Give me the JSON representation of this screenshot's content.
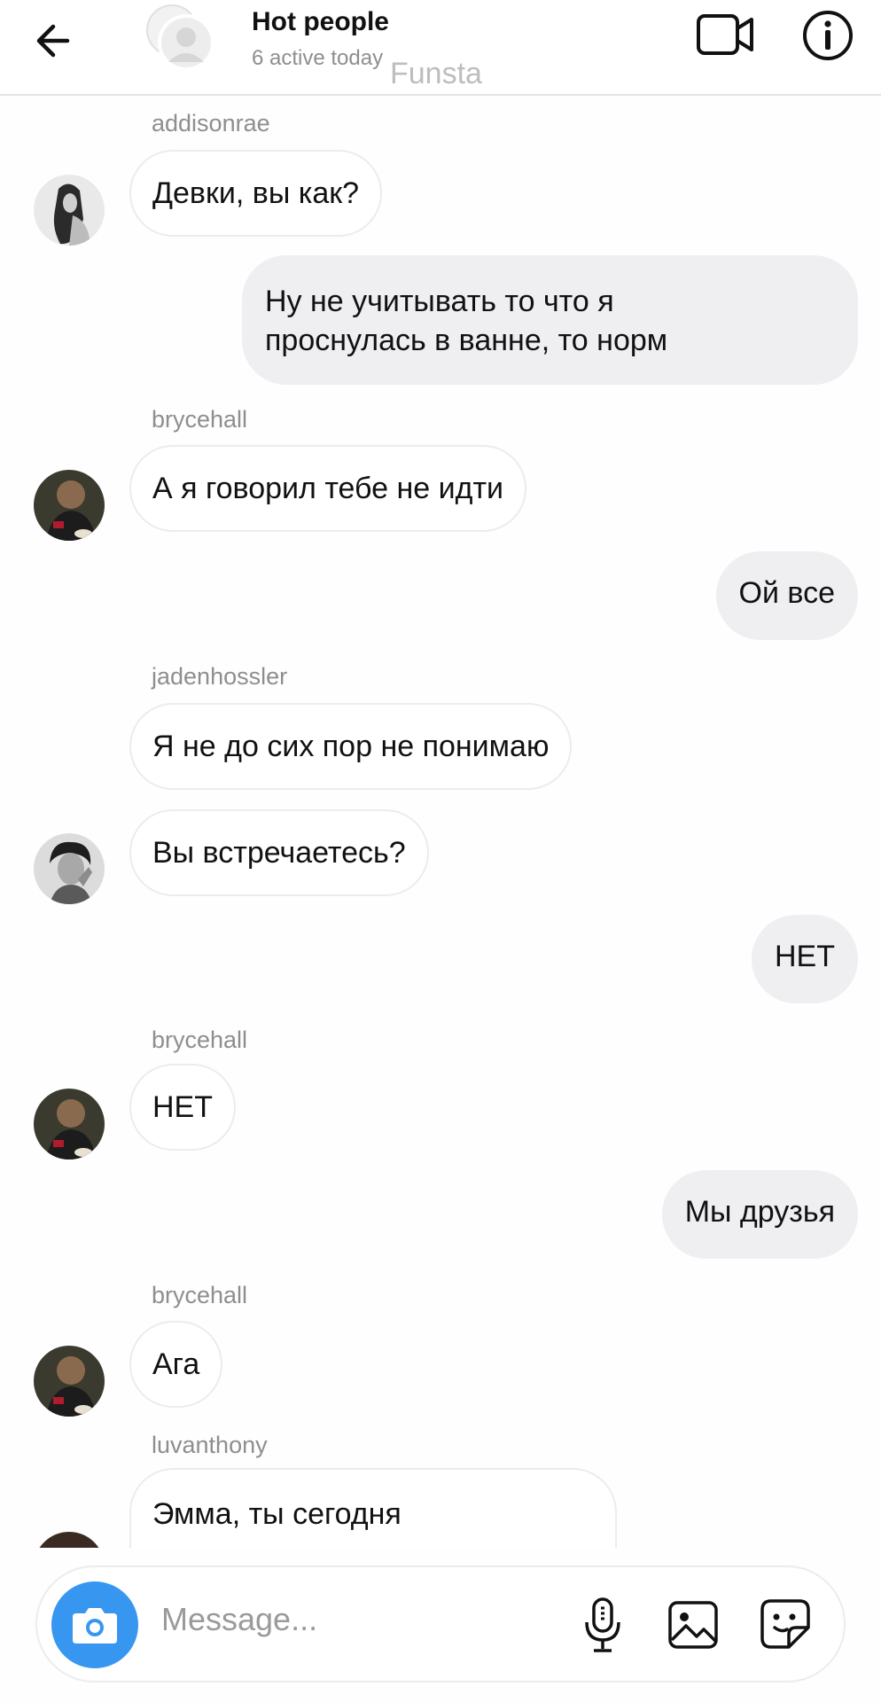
{
  "header": {
    "title": "Hot people",
    "subtitle": "6 active today",
    "watermark": "Funsta",
    "icons": [
      "back-arrow-icon",
      "group-avatar-icon",
      "video-call-icon",
      "info-icon"
    ]
  },
  "messages": [
    {
      "sender": "addisonrae",
      "direction": "in",
      "text": "Девки, вы как?"
    },
    {
      "sender": "me",
      "direction": "out",
      "lines": [
        "Ну не учитывать то что я",
        "проснулась в ванне, то норм"
      ]
    },
    {
      "sender": "brycehall",
      "direction": "in",
      "text": "А я говорил тебе не идти"
    },
    {
      "sender": "me",
      "direction": "out",
      "text": "Ой все"
    },
    {
      "sender": "jadenhossler",
      "direction": "in",
      "text": "Я не до сих пор не понимаю"
    },
    {
      "sender": "jadenhossler",
      "direction": "in",
      "text": "Вы встречаетесь?"
    },
    {
      "sender": "me",
      "direction": "out",
      "text": "НЕТ"
    },
    {
      "sender": "brycehall",
      "direction": "in",
      "text": "НЕТ"
    },
    {
      "sender": "me",
      "direction": "out",
      "text": "Мы друзья"
    },
    {
      "sender": "brycehall",
      "direction": "in",
      "text": "Ага"
    },
    {
      "sender": "luvanthony",
      "direction": "in",
      "text": "Эмма, ты сегодня"
    }
  ],
  "composer": {
    "placeholder": "Message...",
    "accent": "#3797f0",
    "icons": [
      "camera-icon",
      "microphone-icon",
      "gallery-icon",
      "sticker-icon"
    ]
  }
}
